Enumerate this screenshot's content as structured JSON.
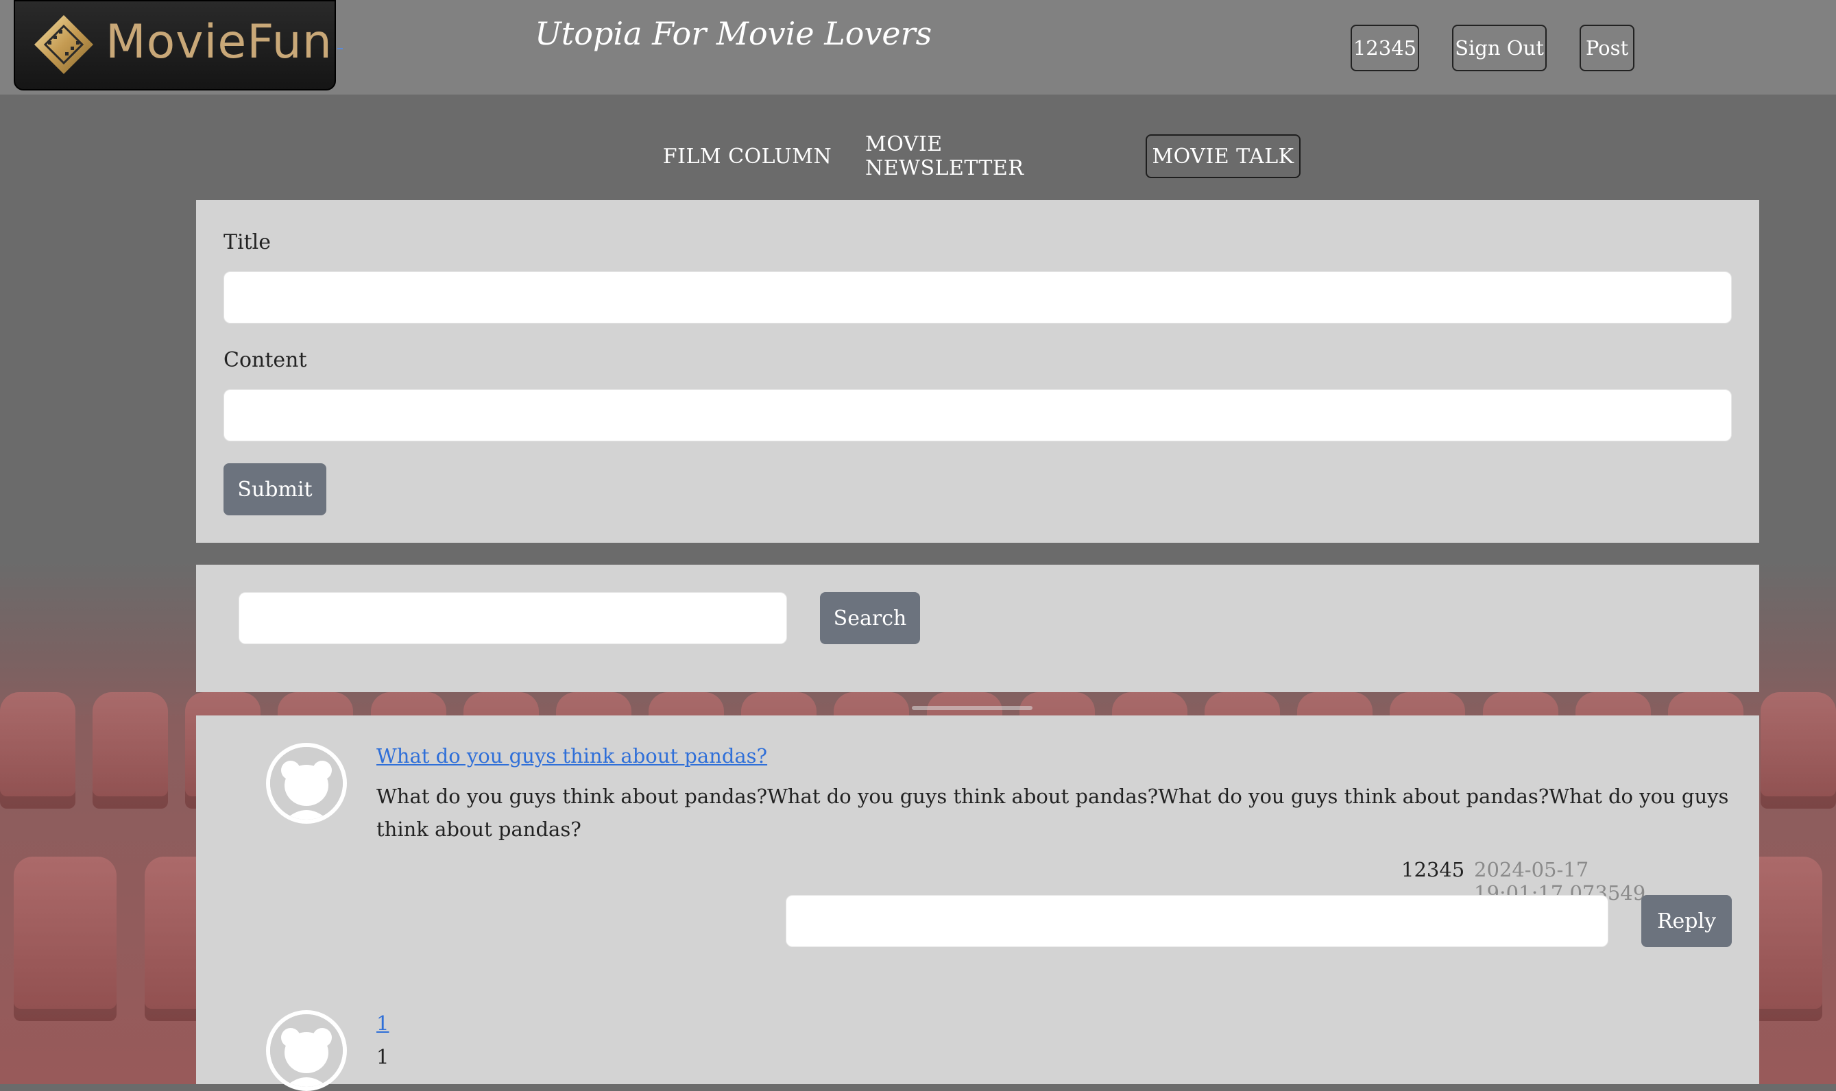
{
  "header": {
    "logo_text": "MovieFun",
    "tagline": "Utopia For Movie Lovers",
    "user_label": "12345",
    "sign_out_label": "Sign Out",
    "post_label": "Post"
  },
  "nav": {
    "items": [
      {
        "label": "FILM COLUMN",
        "active": false
      },
      {
        "label": "MOVIE NEWSLETTER",
        "active": false
      },
      {
        "label": "MOVIE TALK",
        "active": true
      }
    ]
  },
  "post_form": {
    "title_label": "Title",
    "title_value": "",
    "content_label": "Content",
    "content_value": "",
    "submit_label": "Submit"
  },
  "search": {
    "value": "",
    "button_label": "Search"
  },
  "posts": [
    {
      "title": "What do you guys think about pandas?",
      "body": "What do you guys think about pandas?What do you guys think about pandas?What do you guys think about pandas?What do you guys think about pandas?",
      "author": "12345",
      "timestamp": "2024-05-17 19:01:17.073549",
      "reply_value": "",
      "reply_label": "Reply"
    },
    {
      "title": "1",
      "body": "1"
    }
  ],
  "colors": {
    "topbar": "#818181",
    "panel": "#d3d3d3",
    "button": "#6c737e",
    "link": "#2f6fd8",
    "logo_gold": "#c9a878"
  }
}
